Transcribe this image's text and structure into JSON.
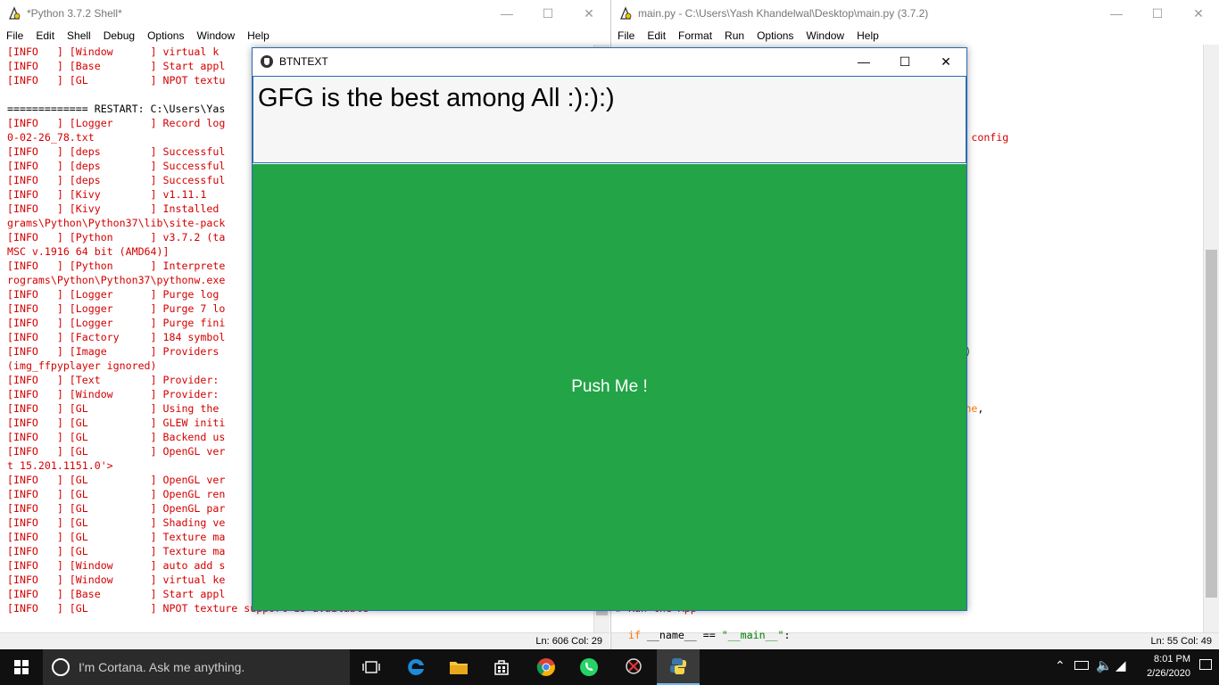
{
  "shell_window": {
    "title": "*Python 3.7.2 Shell*",
    "menu": [
      "File",
      "Edit",
      "Shell",
      "Debug",
      "Options",
      "Window",
      "Help"
    ],
    "lines": [
      "[INFO   ] [Window      ] virtual k",
      "[INFO   ] [Base        ] Start appl",
      "[INFO   ] [GL          ] NPOT textu",
      "",
      "============= RESTART: C:\\Users\\Yas",
      "[INFO   ] [Logger      ] Record log",
      "0-02-26_78.txt",
      "[INFO   ] [deps        ] Successful",
      "[INFO   ] [deps        ] Successful",
      "[INFO   ] [deps        ] Successful",
      "[INFO   ] [Kivy        ] v1.11.1",
      "[INFO   ] [Kivy        ] Installed",
      "grams\\Python\\Python37\\lib\\site-pack",
      "[INFO   ] [Python      ] v3.7.2 (ta",
      "MSC v.1916 64 bit (AMD64)]",
      "[INFO   ] [Python      ] Interprete",
      "rograms\\Python\\Python37\\pythonw.exe",
      "[INFO   ] [Logger      ] Purge log",
      "[INFO   ] [Logger      ] Purge 7 lo",
      "[INFO   ] [Logger      ] Purge fini",
      "[INFO   ] [Factory     ] 184 symbol",
      "[INFO   ] [Image       ] Providers",
      "(img_ffpyplayer ignored)",
      "[INFO   ] [Text        ] Provider:",
      "[INFO   ] [Window      ] Provider:",
      "[INFO   ] [GL          ] Using the",
      "[INFO   ] [GL          ] GLEW initi",
      "[INFO   ] [GL          ] Backend us",
      "[INFO   ] [GL          ] OpenGL ver",
      "t 15.201.1151.0'>",
      "[INFO   ] [GL          ] OpenGL ver",
      "[INFO   ] [GL          ] OpenGL ren",
      "[INFO   ] [GL          ] OpenGL par",
      "[INFO   ] [GL          ] Shading ve",
      "[INFO   ] [GL          ] Texture ma",
      "[INFO   ] [GL          ] Texture ma",
      "[INFO   ] [Window      ] auto add s",
      "[INFO   ] [Window      ] virtual ke",
      "[INFO   ] [Base        ] Start appl",
      "[INFO   ] [GL          ] NPOT texture support is available"
    ],
    "status": "Ln: 606   Col: 29"
  },
  "editor_window": {
    "title": "main.py - C:\\Users\\Yash Khandelwal\\Desktop\\main.py (3.7.2)",
    "menu": [
      "File",
      "Edit",
      "Format",
      "Run",
      "Options",
      "Window",
      "Help"
    ],
    "fragments": [
      {
        "row": 6,
        "col": 50,
        "text": "module config",
        "color": "#d40000"
      },
      {
        "row": 21,
        "col": 50,
        "text": "cal', )",
        "color": "#008000"
      },
      {
        "row": 25,
        "col": 49,
        "text": "_y = ",
        "color": "#000000"
      },
      {
        "row": 25,
        "col": 54,
        "text": "None",
        "color": "#ff7700"
      },
      {
        "row": 25,
        "col": 58,
        "text": ",",
        "color": "#000000"
      },
      {
        "row": 26,
        "col": 49,
        "text": "100)",
        "color": "#000000"
      },
      {
        "row": 31,
        "col": 49,
        "text": ", 1),",
        "color": "#000000"
      },
      {
        "row": 39,
        "col": 0,
        "text": "# Run the App",
        "color": "#d40000"
      }
    ],
    "main_line_kw": "if",
    "main_line_mid": " __name__ == ",
    "main_line_str": "\"__main__\"",
    "main_line_end": ":",
    "status": "Ln: 55   Col: 49"
  },
  "kivy_window": {
    "title": "BTNTEXT",
    "label_text": "GFG is the best among All :):):)",
    "button_text": "Push Me !"
  },
  "taskbar": {
    "search_placeholder": "I'm Cortana. Ask me anything.",
    "time": "8:01 PM",
    "date": "2/26/2020"
  }
}
